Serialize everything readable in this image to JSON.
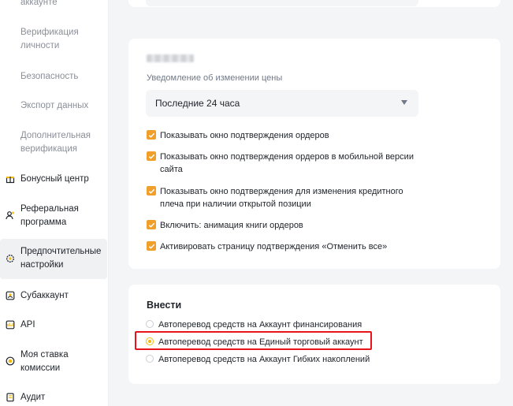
{
  "sidebar": {
    "sub_items": [
      {
        "label": "аккаунте"
      },
      {
        "label": "Верификация личности"
      },
      {
        "label": "Безопасность"
      },
      {
        "label": "Экспорт данных"
      },
      {
        "label": "Дополнительная верификация"
      }
    ],
    "items": [
      {
        "label": "Бонусный центр",
        "icon": "gift-icon"
      },
      {
        "label": "Реферальная программа",
        "icon": "user-add-icon"
      },
      {
        "label": "Предпочтительные настройки",
        "icon": "settings-gear-icon",
        "active": true
      },
      {
        "label": "Субаккаунт",
        "icon": "subaccount-icon"
      },
      {
        "label": "API",
        "icon": "api-icon"
      },
      {
        "label": "Моя ставка комиссии",
        "icon": "commission-icon"
      },
      {
        "label": "Аудит",
        "icon": "audit-icon"
      }
    ]
  },
  "price_panel": {
    "field_label": "Уведомление об изменении цены",
    "select_value": "Последние 24 часа",
    "checkboxes": [
      {
        "label": "Показывать окно подтверждения ордеров",
        "checked": true
      },
      {
        "label": "Показывать окно подтверждения ордеров в мобильной версии сайта",
        "checked": true
      },
      {
        "label": "Показывать окно подтверждения для изменения кредитного плеча при наличии открытой позиции",
        "checked": true
      },
      {
        "label": "Включить: анимация книги ордеров",
        "checked": true
      },
      {
        "label": "Активировать страницу подтверждения «Отменить все»",
        "checked": true
      }
    ]
  },
  "deposit_panel": {
    "title": "Внести",
    "options": [
      {
        "label": "Автоперевод средств на Аккаунт финансирования",
        "selected": false
      },
      {
        "label": "Автоперевод средств на Единый торговый аккаунт",
        "selected": true
      },
      {
        "label": "Автоперевод средств на Аккаунт Гибких накоплений",
        "selected": false
      }
    ]
  },
  "colors": {
    "accent": "#f0a02a",
    "radio_selected": "#f0b90b",
    "highlight": "#e8141b",
    "background": "#f4f5f7"
  }
}
